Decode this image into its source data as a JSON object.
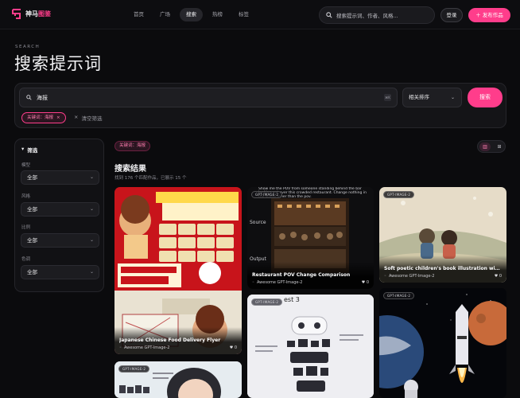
{
  "brand": {
    "name_part1": "神马",
    "name_part2": "图鉴"
  },
  "nav": [
    "首页",
    "广场",
    "搜索",
    "热榜",
    "标签"
  ],
  "top_search_placeholder": "搜索提示词、作者、风格...",
  "login_label": "登录",
  "publish_label": "发布作品",
  "eyebrow": "SEARCH",
  "page_title": "搜索提示词",
  "search": {
    "value": "海报",
    "kbd": "⌘K",
    "sort_label": "相关排序",
    "button": "搜索"
  },
  "active_chip": "关键词：海报",
  "clear_filter": "清空筛选",
  "sidebar": {
    "title": "筛选",
    "filters": [
      {
        "label": "模型",
        "value": "全部"
      },
      {
        "label": "风格",
        "value": "全部"
      },
      {
        "label": "比例",
        "value": "全部"
      },
      {
        "label": "色调",
        "value": "全部"
      }
    ]
  },
  "results": {
    "chip": "关键词：海报",
    "title": "搜索结果",
    "count_text": "找到 176 个匹配作品，已展示 15 个"
  },
  "cards": [
    {
      "badge": "GPT-IMAGE-2",
      "title": "Japanese Chinese Food Delivery Flyer",
      "author": "Awesome GPT-Image-2",
      "likes": "0"
    },
    {
      "badge": "GPT-IMAGE-2",
      "title": "Restaurant POV Change Comparison",
      "author": "Awesome GPT-Image-2",
      "likes": "0",
      "overlay_source": "Source",
      "overlay_output": "Output",
      "overlay_prompt": "Show me the POV from someone standing behind the bar looking out over this crowded restaurant. Change nothing in the scene other than the pov."
    },
    {
      "badge": "GPT-IMAGE-2",
      "title": "Soft poetic children's book illustration with wa...",
      "author": "Awesome GPT-Image-2",
      "likes": "0"
    },
    {
      "badge": "GPT-IMAGE-2",
      "title": "",
      "author": "",
      "likes": "",
      "overlay_heading": "est 3"
    },
    {
      "badge": "GPT-IMAGE-2",
      "title": "",
      "author": "",
      "likes": ""
    },
    {
      "badge": "GPT-IMAGE-2",
      "title": "",
      "author": "",
      "likes": ""
    }
  ],
  "colors": {
    "accent": "#ff3d8b",
    "bg": "#0b0b0d"
  }
}
